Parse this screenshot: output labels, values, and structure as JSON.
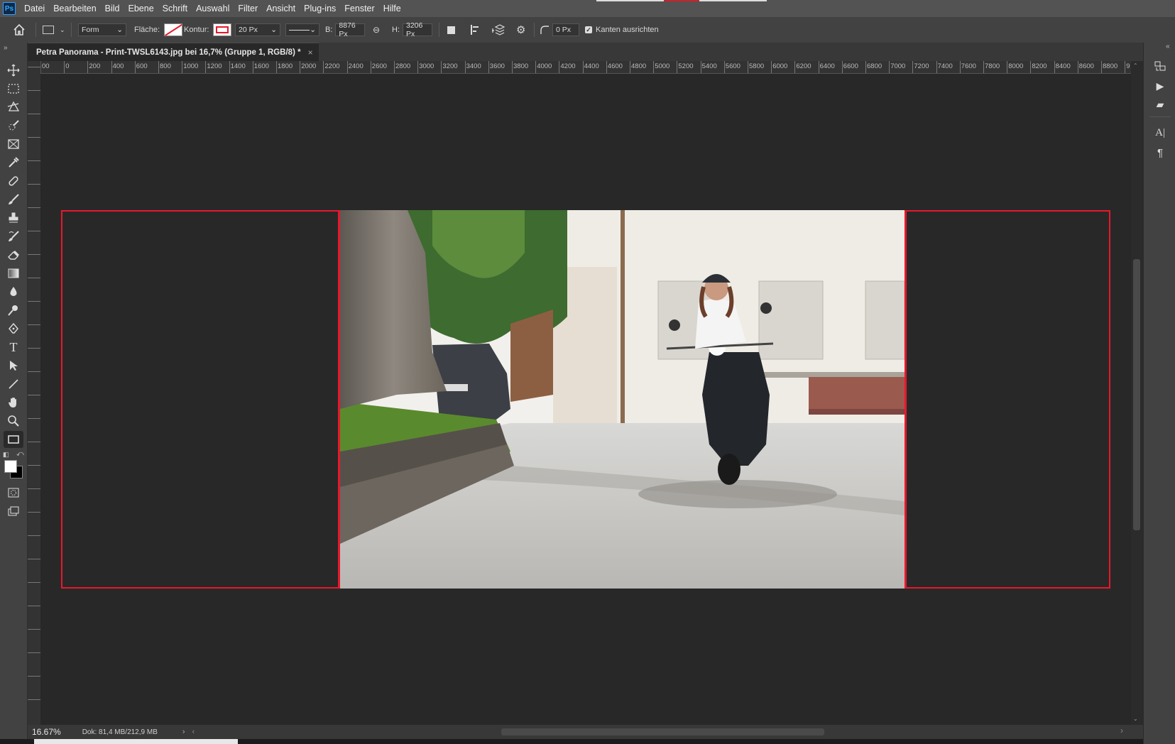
{
  "app": {
    "logo": "Ps"
  },
  "menu": [
    "Datei",
    "Bearbeiten",
    "Bild",
    "Ebene",
    "Schrift",
    "Auswahl",
    "Filter",
    "Ansicht",
    "Plug-ins",
    "Fenster",
    "Hilfe"
  ],
  "options": {
    "mode": "Form",
    "fill_label": "Fläche:",
    "stroke_label": "Kontur:",
    "stroke_width": "20 Px",
    "width_label": "B:",
    "width_value": "8876 Px",
    "height_label": "H:",
    "height_value": "3206 Px",
    "radius_value": "0 Px",
    "align_edges_label": "Kanten ausrichten",
    "align_edges_checked": true,
    "stroke_color": "#e8182c"
  },
  "document": {
    "tab_title": "Petra Panorama - Print-TWSL6143.jpg bei 16,7% (Gruppe 1, RGB/8) *",
    "close": "×"
  },
  "ruler": {
    "h_labels": [
      "00",
      "0",
      "200",
      "400",
      "600",
      "800",
      "1000",
      "1200",
      "1400",
      "1600",
      "1800",
      "2000",
      "2200",
      "2400",
      "2600",
      "2800",
      "3000",
      "3200",
      "3400",
      "3600",
      "3800",
      "4000",
      "4200",
      "4400",
      "4600",
      "4800",
      "5000",
      "5200",
      "5400",
      "5600",
      "5800",
      "6000",
      "6200",
      "6400",
      "6600",
      "6800",
      "7000",
      "7200",
      "7400",
      "7600",
      "7800",
      "8000",
      "8200",
      "8400",
      "8600",
      "8800",
      "9"
    ]
  },
  "status": {
    "zoom": "16.67%",
    "doc_info": "Dok: 81,4 MB/212,9 MB"
  },
  "tools": [
    "move-tool",
    "marquee-tool",
    "lasso-tool",
    "quick-select-tool",
    "frame-tool",
    "eyedropper-tool",
    "healing-brush-tool",
    "brush-tool",
    "clone-stamp-tool",
    "history-brush-tool",
    "eraser-tool",
    "gradient-tool",
    "blur-tool",
    "dodge-tool",
    "pen-tool",
    "type-tool",
    "path-select-tool",
    "line-tool",
    "hand-tool",
    "zoom-tool",
    "rectangle-tool"
  ],
  "colors": {
    "accent_red": "#e8182c",
    "foreground": "#ffffff",
    "background": "#000000"
  }
}
